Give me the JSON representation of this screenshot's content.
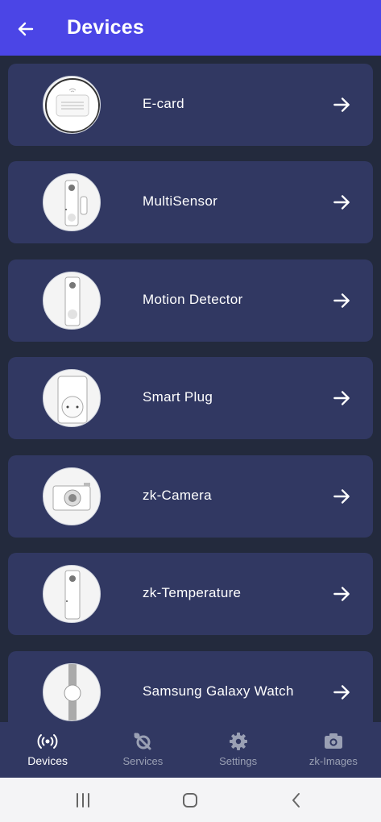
{
  "header": {
    "title": "Devices",
    "back_icon": "arrow-left-icon"
  },
  "devices": [
    {
      "label": "E-card",
      "icon": "e-card-icon"
    },
    {
      "label": "MultiSensor",
      "icon": "multisensor-icon"
    },
    {
      "label": "Motion Detector",
      "icon": "motion-detector-icon"
    },
    {
      "label": "Smart Plug",
      "icon": "smart-plug-icon"
    },
    {
      "label": "zk-Camera",
      "icon": "camera-icon"
    },
    {
      "label": "zk-Temperature",
      "icon": "temperature-sensor-icon"
    },
    {
      "label": "Samsung Galaxy Watch",
      "icon": "watch-icon"
    }
  ],
  "bottom_nav": {
    "items": [
      {
        "label": "Devices",
        "icon": "broadcast-icon",
        "active": true
      },
      {
        "label": "Services",
        "icon": "services-icon",
        "active": false
      },
      {
        "label": "Settings",
        "icon": "gear-icon",
        "active": false
      },
      {
        "label": "zk-Images",
        "icon": "camera-icon",
        "active": false
      }
    ]
  },
  "system_nav": {
    "recents_icon": "recents-icon",
    "home_icon": "home-icon",
    "back_icon": "back-chevron-icon"
  },
  "colors": {
    "app_bar": "#4b45e6",
    "background": "#232a3d",
    "card": "#313862",
    "nav_active": "#ffffff",
    "nav_inactive": "#9aa0b4"
  }
}
